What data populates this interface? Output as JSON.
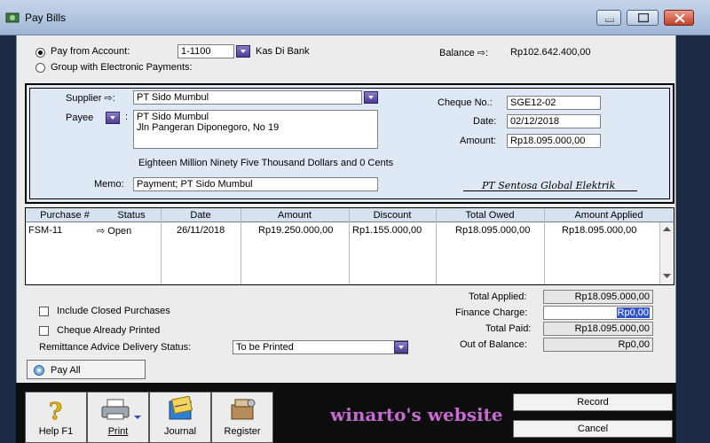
{
  "window": {
    "title": "Pay Bills"
  },
  "account": {
    "pay_from_label": "Pay from Account:",
    "pay_from_checked": true,
    "group_label": "Group with Electronic Payments:",
    "account_no": "1-1100",
    "account_name": "Kas Di Bank",
    "balance_label": "Balance ⇨:",
    "balance_value": "Rp102.642.400,00"
  },
  "payee_panel": {
    "supplier_label": "Supplier ⇨:",
    "supplier_value": "PT Sido Mumbul",
    "payee_label": "Payee",
    "payee_line1": "PT Sido Mumbul",
    "payee_line2": "Jln Pangeran Diponegoro, No 19",
    "amount_words": "Eighteen Million Ninety Five Thousand Dollars and 0 Cents",
    "memo_label": "Memo:",
    "memo_value": "Payment; PT Sido Mumbul",
    "cheque_label": "Cheque No.:",
    "cheque_value": "SGE12-02",
    "date_label": "Date:",
    "date_value": "02/12/2018",
    "amount_label": "Amount:",
    "amount_value": "Rp18.095.000,00",
    "signature": "PT Sentosa Global Elektrik"
  },
  "grid": {
    "headers": [
      "Purchase #",
      "Status",
      "Date",
      "Amount",
      "Discount",
      "Total Owed",
      "Amount Applied"
    ],
    "rows": [
      {
        "purchase": "FSM-11",
        "status": "⇨ Open",
        "date": "26/11/2018",
        "amount": "Rp19.250.000,00",
        "discount": "Rp1.155.000,00",
        "owed": "Rp18.095.000,00",
        "applied": "Rp18.095.000,00"
      }
    ]
  },
  "options": {
    "include_closed": "Include Closed Purchases",
    "cheque_printed": "Cheque Already Printed",
    "remittance_label": "Remittance Advice Delivery Status:",
    "remittance_value": "To be Printed",
    "pay_all": "Pay All"
  },
  "totals": {
    "applied_label": "Total Applied:",
    "applied_value": "Rp18.095.000,00",
    "finance_label": "Finance Charge:",
    "finance_value": "Rp0,00",
    "paid_label": "Total Paid:",
    "paid_value": "Rp18.095.000,00",
    "balance_label": "Out of Balance:",
    "balance_value": "Rp0,00"
  },
  "footer": {
    "help": "Help F1",
    "print": "Print",
    "journal": "Journal",
    "register": "Register",
    "record": "Record",
    "cancel": "Cancel",
    "watermark": "winarto's  website"
  },
  "colors": {
    "panel_bg": "#dfe9f5",
    "accent": "#4c3d95",
    "watermark": "#c76bd2"
  }
}
